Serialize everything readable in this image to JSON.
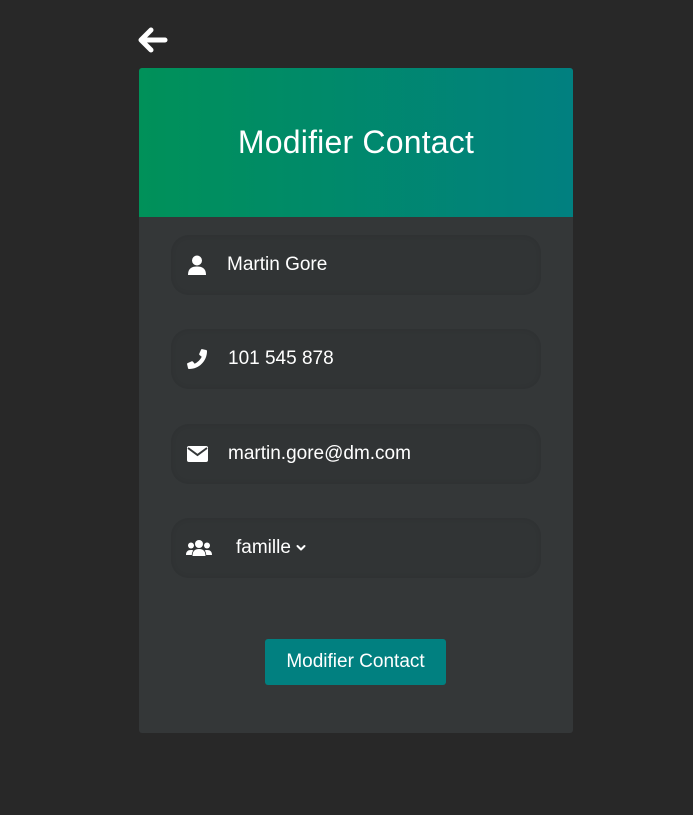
{
  "back": {
    "icon": "arrow-left-icon"
  },
  "form": {
    "title": "Modifier Contact",
    "name": {
      "icon": "user-icon",
      "value": "Martin Gore"
    },
    "phone": {
      "icon": "phone-icon",
      "value": "101 545 878"
    },
    "email": {
      "icon": "envelope-icon",
      "value": "martin.gore@dm.com"
    },
    "group": {
      "icon": "users-icon",
      "selected": "famille"
    },
    "submit_label": "Modifier Contact"
  },
  "colors": {
    "background": "#282828",
    "card": "#343738",
    "header_gradient_start": "#009159",
    "header_gradient_end": "#018080",
    "accent": "#018080"
  }
}
